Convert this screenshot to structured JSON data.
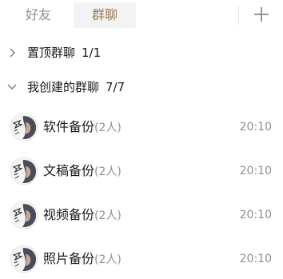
{
  "tabs": {
    "friends": "好友",
    "groups": "群聊"
  },
  "icons": {
    "add": "plus-icon",
    "collapsed": "chevron-right-icon",
    "expanded": "chevron-down-icon",
    "avatar": "group-avatar-icon"
  },
  "colors": {
    "active_tab_bg": "#f3f3f3",
    "active_tab_text": "#9a7b50",
    "muted_text": "#8f8f8f"
  },
  "sections": {
    "pinned": {
      "title": "置顶群聊",
      "count": "1/1",
      "state": "collapsed"
    },
    "created": {
      "title": "我创建的群聊",
      "count": "7/7",
      "state": "expanded"
    }
  },
  "groups": [
    {
      "name": "软件备份",
      "members": "(2人)",
      "time": "20:10"
    },
    {
      "name": "文稿备份",
      "members": "(2人)",
      "time": "20:10"
    },
    {
      "name": "视频备份",
      "members": "(2人)",
      "time": "20:10"
    },
    {
      "name": "照片备份",
      "members": "(2人)",
      "time": "20:10"
    }
  ]
}
